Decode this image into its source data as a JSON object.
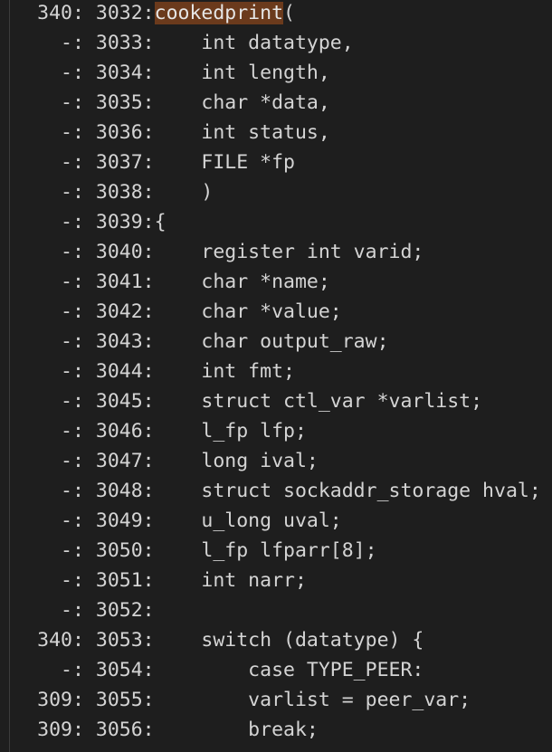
{
  "lines": [
    {
      "count": "340",
      "line": "3032",
      "code": "",
      "highlight": "cookedprint",
      "after": "("
    },
    {
      "count": "-",
      "line": "3033",
      "code": "    int datatype,"
    },
    {
      "count": "-",
      "line": "3034",
      "code": "    int length,"
    },
    {
      "count": "-",
      "line": "3035",
      "code": "    char *data,"
    },
    {
      "count": "-",
      "line": "3036",
      "code": "    int status,"
    },
    {
      "count": "-",
      "line": "3037",
      "code": "    FILE *fp"
    },
    {
      "count": "-",
      "line": "3038",
      "code": "    )"
    },
    {
      "count": "-",
      "line": "3039",
      "code": "{"
    },
    {
      "count": "-",
      "line": "3040",
      "code": "    register int varid;"
    },
    {
      "count": "-",
      "line": "3041",
      "code": "    char *name;"
    },
    {
      "count": "-",
      "line": "3042",
      "code": "    char *value;"
    },
    {
      "count": "-",
      "line": "3043",
      "code": "    char output_raw;"
    },
    {
      "count": "-",
      "line": "3044",
      "code": "    int fmt;"
    },
    {
      "count": "-",
      "line": "3045",
      "code": "    struct ctl_var *varlist;"
    },
    {
      "count": "-",
      "line": "3046",
      "code": "    l_fp lfp;"
    },
    {
      "count": "-",
      "line": "3047",
      "code": "    long ival;"
    },
    {
      "count": "-",
      "line": "3048",
      "code": "    struct sockaddr_storage hval;"
    },
    {
      "count": "-",
      "line": "3049",
      "code": "    u_long uval;"
    },
    {
      "count": "-",
      "line": "3050",
      "code": "    l_fp lfparr[8];"
    },
    {
      "count": "-",
      "line": "3051",
      "code": "    int narr;"
    },
    {
      "count": "-",
      "line": "3052",
      "code": ""
    },
    {
      "count": "340",
      "line": "3053",
      "code": "    switch (datatype) {"
    },
    {
      "count": "-",
      "line": "3054",
      "code": "        case TYPE_PEER:"
    },
    {
      "count": "309",
      "line": "3055",
      "code": "        varlist = peer_var;"
    },
    {
      "count": "309",
      "line": "3056",
      "code": "        break;"
    }
  ],
  "colors": {
    "background": "#1e1e1e",
    "text": "#d4d4d4",
    "highlight_bg": "#6b3a1c"
  }
}
